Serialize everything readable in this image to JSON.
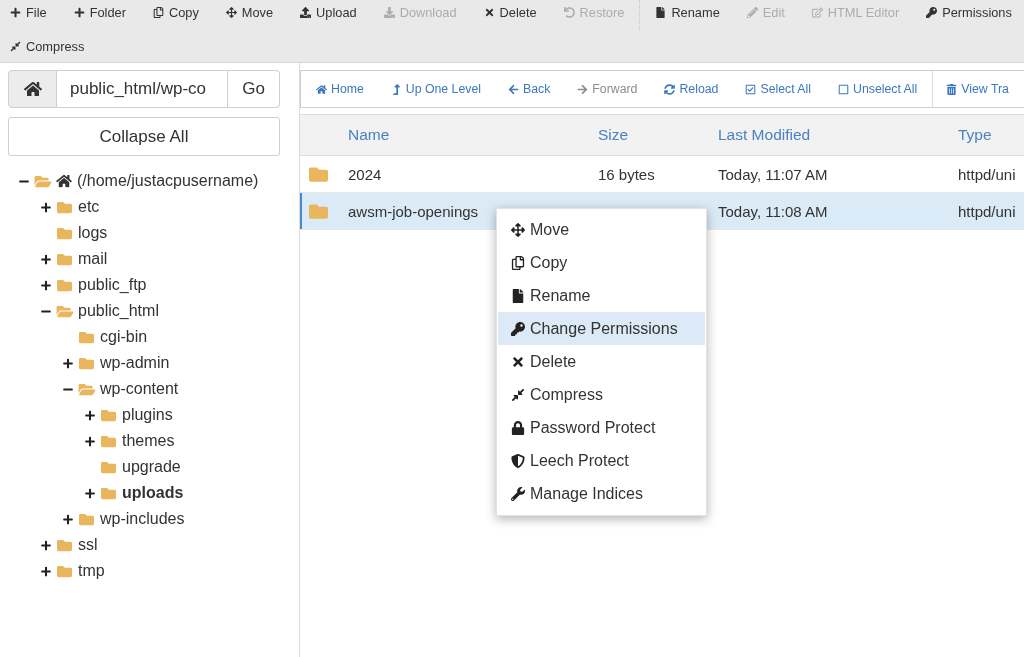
{
  "toolbar": {
    "rows": [
      {
        "groups": [
          {
            "items": [
              {
                "label": "File",
                "disabled": false
              },
              {
                "label": "Folder",
                "disabled": false
              },
              {
                "label": "Copy",
                "disabled": false
              },
              {
                "label": "Move",
                "disabled": false
              },
              {
                "label": "Upload",
                "disabled": false
              },
              {
                "label": "Download",
                "disabled": true
              },
              {
                "label": "Delete",
                "disabled": false
              },
              {
                "label": "Restore",
                "disabled": true
              }
            ]
          },
          {
            "items": [
              {
                "label": "Rename",
                "disabled": false
              },
              {
                "label": "Edit",
                "disabled": true
              },
              {
                "label": "HTML Editor",
                "disabled": true
              },
              {
                "label": "Permissions",
                "disabled": false
              }
            ]
          }
        ]
      },
      {
        "groups": [
          {
            "items": [
              {
                "label": "Compress",
                "disabled": false
              }
            ]
          }
        ]
      }
    ]
  },
  "path_bar": {
    "value": "public_html/wp-co",
    "go_button": "Go"
  },
  "collapse_button": "Collapse All",
  "tree": {
    "root": {
      "label": "(/home/justacpusername)",
      "expandable": true,
      "expanded": true,
      "selected": false,
      "children": [
        {
          "label": "etc",
          "expandable": true,
          "expanded": false,
          "selected": false
        },
        {
          "label": "logs",
          "expandable": false,
          "expanded": false,
          "selected": false
        },
        {
          "label": "mail",
          "expandable": true,
          "expanded": false,
          "selected": false
        },
        {
          "label": "public_ftp",
          "expandable": true,
          "expanded": false,
          "selected": false
        },
        {
          "label": "public_html",
          "expandable": true,
          "expanded": true,
          "selected": false,
          "children": [
            {
              "label": "cgi-bin",
              "expandable": false,
              "expanded": false,
              "selected": false
            },
            {
              "label": "wp-admin",
              "expandable": true,
              "expanded": false,
              "selected": false
            },
            {
              "label": "wp-content",
              "expandable": true,
              "expanded": true,
              "selected": false,
              "children": [
                {
                  "label": "plugins",
                  "expandable": true,
                  "expanded": false,
                  "selected": false
                },
                {
                  "label": "themes",
                  "expandable": true,
                  "expanded": false,
                  "selected": false
                },
                {
                  "label": "upgrade",
                  "expandable": false,
                  "expanded": false,
                  "selected": false
                },
                {
                  "label": "uploads",
                  "expandable": true,
                  "expanded": false,
                  "selected": true
                }
              ]
            },
            {
              "label": "wp-includes",
              "expandable": true,
              "expanded": false,
              "selected": false
            }
          ]
        },
        {
          "label": "ssl",
          "expandable": true,
          "expanded": false,
          "selected": false
        },
        {
          "label": "tmp",
          "expandable": true,
          "expanded": false,
          "selected": false
        }
      ]
    }
  },
  "nav_bar": {
    "groups": [
      {
        "items": [
          {
            "label": "Home",
            "disabled": false
          },
          {
            "label": "Up One Level",
            "disabled": false
          },
          {
            "label": "Back",
            "disabled": false
          },
          {
            "label": "Forward",
            "disabled": true
          },
          {
            "label": "Reload",
            "disabled": false
          },
          {
            "label": "Select All",
            "disabled": false
          },
          {
            "label": "Unselect All",
            "disabled": false
          }
        ]
      },
      {
        "items": [
          {
            "label": "View Tra",
            "disabled": false
          }
        ]
      }
    ]
  },
  "file_table": {
    "columns": [
      "Name",
      "Size",
      "Last Modified",
      "Type"
    ],
    "rows": [
      {
        "name": "2024",
        "size": "16 bytes",
        "last_modified": "Today, 11:07 AM",
        "type": "httpd/uni",
        "selected": false
      },
      {
        "name": "awsm-job-openings",
        "last_modified": "Today, 11:08 AM",
        "type": "httpd/uni",
        "selected": true
      }
    ]
  },
  "context_menu": {
    "items": [
      {
        "label": "Move",
        "selected": false
      },
      {
        "label": "Copy",
        "selected": false
      },
      {
        "label": "Rename",
        "selected": false
      },
      {
        "label": "Change Permissions",
        "selected": true
      },
      {
        "label": "Delete",
        "selected": false
      },
      {
        "label": "Compress",
        "selected": false
      },
      {
        "label": "Password Protect",
        "selected": false
      },
      {
        "label": "Leech Protect",
        "selected": false
      },
      {
        "label": "Manage Indices",
        "selected": false
      }
    ]
  }
}
